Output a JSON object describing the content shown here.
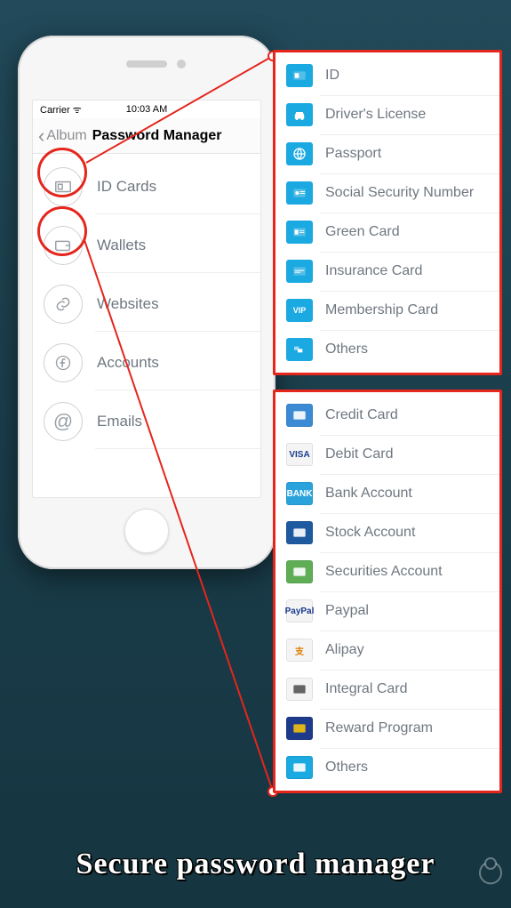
{
  "statusbar": {
    "carrier": "Carrier",
    "time": "10:03 AM"
  },
  "navbar": {
    "back": "Album",
    "title": "Password Manager"
  },
  "menu": [
    {
      "label": "ID Cards"
    },
    {
      "label": "Wallets"
    },
    {
      "label": "Websites"
    },
    {
      "label": "Accounts"
    },
    {
      "label": "Emails"
    }
  ],
  "id_panel": {
    "items": [
      {
        "label": "ID"
      },
      {
        "label": "Driver's License"
      },
      {
        "label": "Passport"
      },
      {
        "label": "Social Security Number"
      },
      {
        "label": "Green Card"
      },
      {
        "label": "Insurance Card"
      },
      {
        "label": "Membership Card"
      },
      {
        "label": "Others"
      }
    ]
  },
  "wallet_panel": {
    "items": [
      {
        "label": "Credit Card",
        "tile_text": "",
        "tile_bg": "#3b8bd4",
        "tile_fg": "#fff"
      },
      {
        "label": "Debit Card",
        "tile_text": "VISA",
        "tile_bg": "#f4f4f4",
        "tile_fg": "#1a3b8f"
      },
      {
        "label": "Bank Account",
        "tile_text": "BANK",
        "tile_bg": "#2aa3dd",
        "tile_fg": "#fff"
      },
      {
        "label": "Stock Account",
        "tile_text": "",
        "tile_bg": "#1e5aa0",
        "tile_fg": "#fff"
      },
      {
        "label": "Securities Account",
        "tile_text": "",
        "tile_bg": "#5fae56",
        "tile_fg": "#fff"
      },
      {
        "label": "Paypal",
        "tile_text": "PayPal",
        "tile_bg": "#f4f4f4",
        "tile_fg": "#1a3b8f"
      },
      {
        "label": "Alipay",
        "tile_text": "支",
        "tile_bg": "#f4f4f4",
        "tile_fg": "#e07b00"
      },
      {
        "label": "Integral Card",
        "tile_text": "",
        "tile_bg": "#f4f4f4",
        "tile_fg": "#555"
      },
      {
        "label": "Reward Program",
        "tile_text": "",
        "tile_bg": "#1e3a8a",
        "tile_fg": "#f3c20b"
      },
      {
        "label": "Others",
        "tile_text": "",
        "tile_bg": "#1ba9e1",
        "tile_fg": "#fff"
      }
    ]
  },
  "caption": "Secure password manager"
}
